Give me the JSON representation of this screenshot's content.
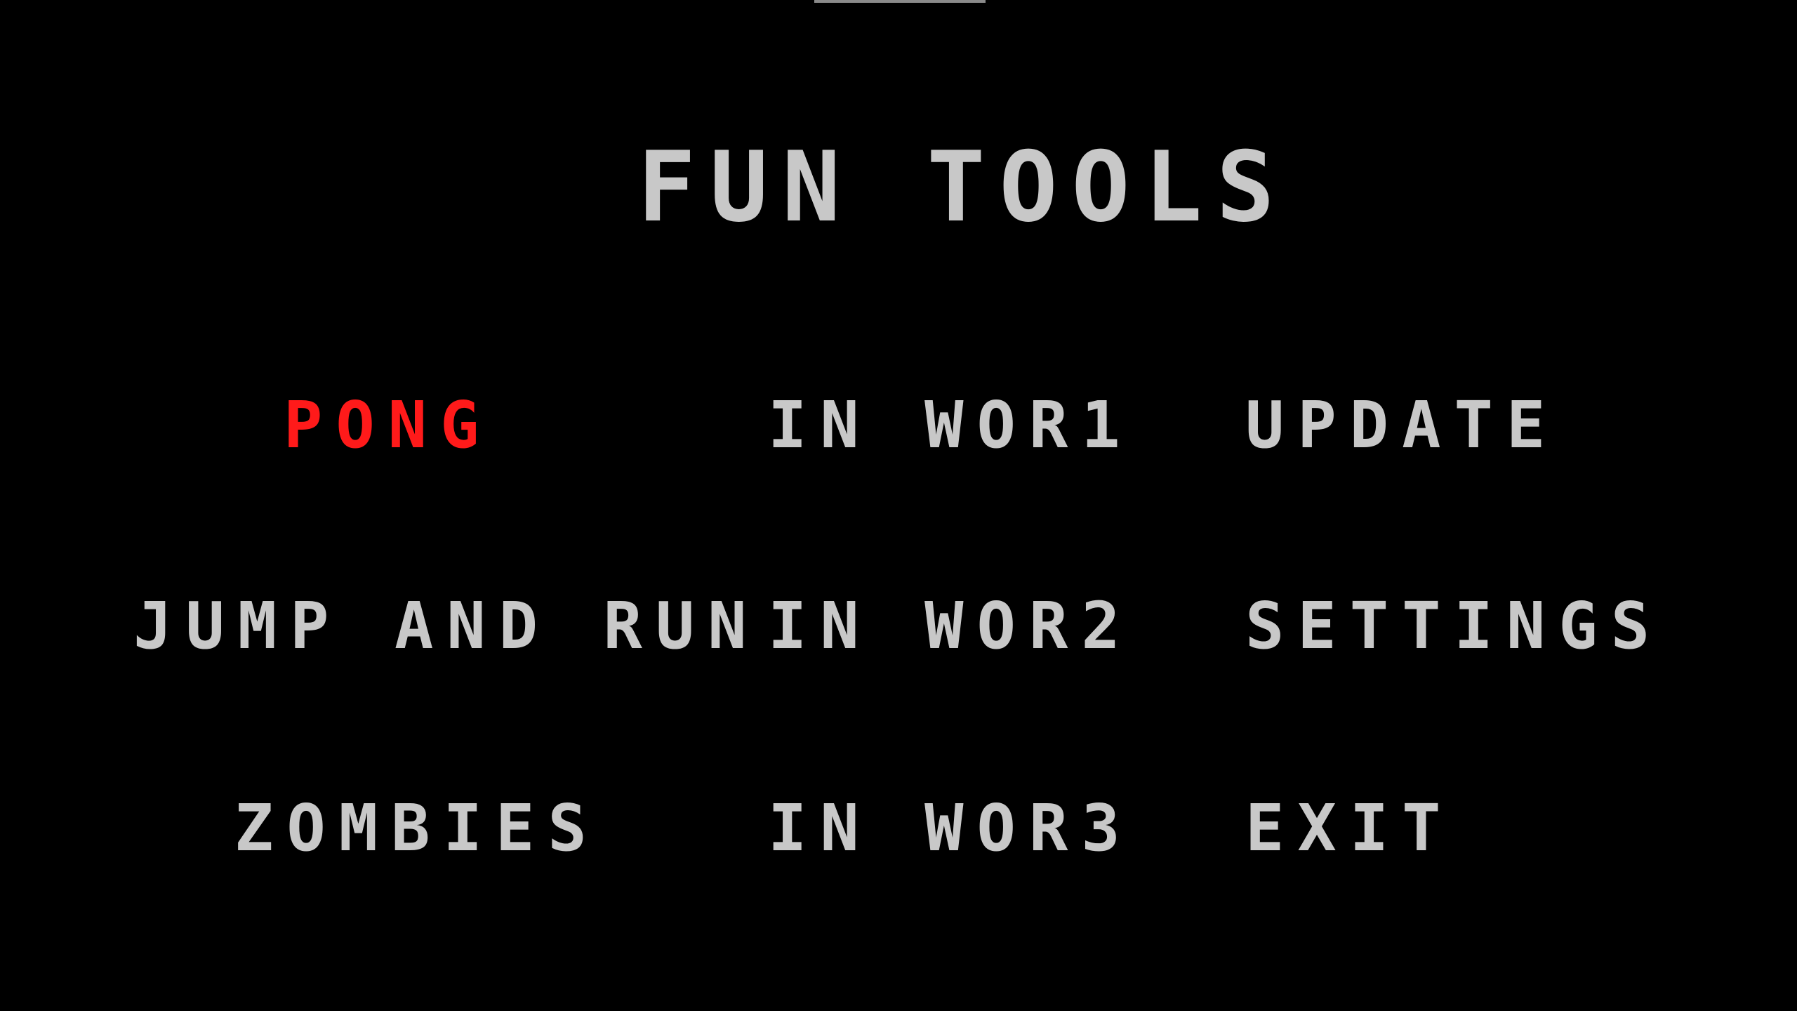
{
  "title": "FUN TOOLS",
  "colors": {
    "background": "#000000",
    "text": "#c8c8c8",
    "selected": "#ff1a1a"
  },
  "menu": {
    "selected": "PONG",
    "items": [
      {
        "label": "PONG"
      },
      {
        "label": "JUMP AND RUN"
      },
      {
        "label": "ZOMBIES"
      },
      {
        "label": "IN WOR1"
      },
      {
        "label": "IN WOR2"
      },
      {
        "label": "IN WOR3"
      },
      {
        "label": "UPDATE"
      },
      {
        "label": "SETTINGS"
      },
      {
        "label": "EXIT"
      }
    ]
  }
}
